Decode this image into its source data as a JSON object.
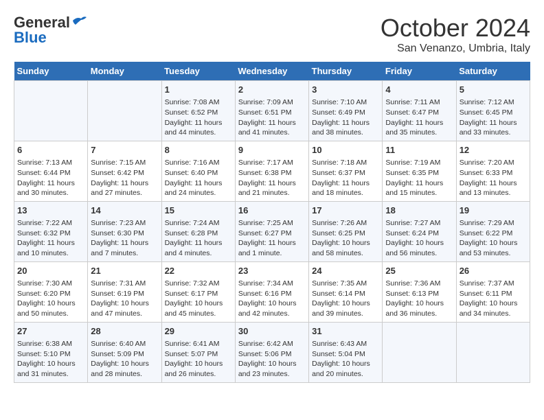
{
  "logo": {
    "line1": "General",
    "line2": "Blue",
    "bird_color": "#1a6bbf"
  },
  "title": "October 2024",
  "subtitle": "San Venanzo, Umbria, Italy",
  "days_of_week": [
    "Sunday",
    "Monday",
    "Tuesday",
    "Wednesday",
    "Thursday",
    "Friday",
    "Saturday"
  ],
  "weeks": [
    [
      {
        "day": "",
        "info": ""
      },
      {
        "day": "",
        "info": ""
      },
      {
        "day": "1",
        "info": "Sunrise: 7:08 AM\nSunset: 6:52 PM\nDaylight: 11 hours and 44 minutes."
      },
      {
        "day": "2",
        "info": "Sunrise: 7:09 AM\nSunset: 6:51 PM\nDaylight: 11 hours and 41 minutes."
      },
      {
        "day": "3",
        "info": "Sunrise: 7:10 AM\nSunset: 6:49 PM\nDaylight: 11 hours and 38 minutes."
      },
      {
        "day": "4",
        "info": "Sunrise: 7:11 AM\nSunset: 6:47 PM\nDaylight: 11 hours and 35 minutes."
      },
      {
        "day": "5",
        "info": "Sunrise: 7:12 AM\nSunset: 6:45 PM\nDaylight: 11 hours and 33 minutes."
      }
    ],
    [
      {
        "day": "6",
        "info": "Sunrise: 7:13 AM\nSunset: 6:44 PM\nDaylight: 11 hours and 30 minutes."
      },
      {
        "day": "7",
        "info": "Sunrise: 7:15 AM\nSunset: 6:42 PM\nDaylight: 11 hours and 27 minutes."
      },
      {
        "day": "8",
        "info": "Sunrise: 7:16 AM\nSunset: 6:40 PM\nDaylight: 11 hours and 24 minutes."
      },
      {
        "day": "9",
        "info": "Sunrise: 7:17 AM\nSunset: 6:38 PM\nDaylight: 11 hours and 21 minutes."
      },
      {
        "day": "10",
        "info": "Sunrise: 7:18 AM\nSunset: 6:37 PM\nDaylight: 11 hours and 18 minutes."
      },
      {
        "day": "11",
        "info": "Sunrise: 7:19 AM\nSunset: 6:35 PM\nDaylight: 11 hours and 15 minutes."
      },
      {
        "day": "12",
        "info": "Sunrise: 7:20 AM\nSunset: 6:33 PM\nDaylight: 11 hours and 13 minutes."
      }
    ],
    [
      {
        "day": "13",
        "info": "Sunrise: 7:22 AM\nSunset: 6:32 PM\nDaylight: 11 hours and 10 minutes."
      },
      {
        "day": "14",
        "info": "Sunrise: 7:23 AM\nSunset: 6:30 PM\nDaylight: 11 hours and 7 minutes."
      },
      {
        "day": "15",
        "info": "Sunrise: 7:24 AM\nSunset: 6:28 PM\nDaylight: 11 hours and 4 minutes."
      },
      {
        "day": "16",
        "info": "Sunrise: 7:25 AM\nSunset: 6:27 PM\nDaylight: 11 hours and 1 minute."
      },
      {
        "day": "17",
        "info": "Sunrise: 7:26 AM\nSunset: 6:25 PM\nDaylight: 10 hours and 58 minutes."
      },
      {
        "day": "18",
        "info": "Sunrise: 7:27 AM\nSunset: 6:24 PM\nDaylight: 10 hours and 56 minutes."
      },
      {
        "day": "19",
        "info": "Sunrise: 7:29 AM\nSunset: 6:22 PM\nDaylight: 10 hours and 53 minutes."
      }
    ],
    [
      {
        "day": "20",
        "info": "Sunrise: 7:30 AM\nSunset: 6:20 PM\nDaylight: 10 hours and 50 minutes."
      },
      {
        "day": "21",
        "info": "Sunrise: 7:31 AM\nSunset: 6:19 PM\nDaylight: 10 hours and 47 minutes."
      },
      {
        "day": "22",
        "info": "Sunrise: 7:32 AM\nSunset: 6:17 PM\nDaylight: 10 hours and 45 minutes."
      },
      {
        "day": "23",
        "info": "Sunrise: 7:34 AM\nSunset: 6:16 PM\nDaylight: 10 hours and 42 minutes."
      },
      {
        "day": "24",
        "info": "Sunrise: 7:35 AM\nSunset: 6:14 PM\nDaylight: 10 hours and 39 minutes."
      },
      {
        "day": "25",
        "info": "Sunrise: 7:36 AM\nSunset: 6:13 PM\nDaylight: 10 hours and 36 minutes."
      },
      {
        "day": "26",
        "info": "Sunrise: 7:37 AM\nSunset: 6:11 PM\nDaylight: 10 hours and 34 minutes."
      }
    ],
    [
      {
        "day": "27",
        "info": "Sunrise: 6:38 AM\nSunset: 5:10 PM\nDaylight: 10 hours and 31 minutes."
      },
      {
        "day": "28",
        "info": "Sunrise: 6:40 AM\nSunset: 5:09 PM\nDaylight: 10 hours and 28 minutes."
      },
      {
        "day": "29",
        "info": "Sunrise: 6:41 AM\nSunset: 5:07 PM\nDaylight: 10 hours and 26 minutes."
      },
      {
        "day": "30",
        "info": "Sunrise: 6:42 AM\nSunset: 5:06 PM\nDaylight: 10 hours and 23 minutes."
      },
      {
        "day": "31",
        "info": "Sunrise: 6:43 AM\nSunset: 5:04 PM\nDaylight: 10 hours and 20 minutes."
      },
      {
        "day": "",
        "info": ""
      },
      {
        "day": "",
        "info": ""
      }
    ]
  ]
}
